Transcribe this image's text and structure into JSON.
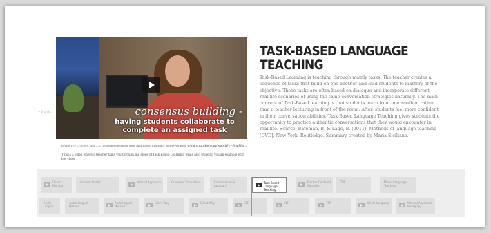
{
  "side_label": "~ 6 tasks",
  "video": {
    "caption_line1": "consensus building -",
    "caption_line2": "having students collaborate to complete an assigned task"
  },
  "citation": {
    "text": "BridgeTEFL. (2009, May 27). Teaching Speaking with Task-Based Learning. Retrieved from",
    "link": "www.youtube.com/watch?v=8jmWb..."
  },
  "video_description": "This is a video where a teacher talks you through the steps of Task-Based-Learning, while also showing you an example with her class.",
  "title": "TASK-BASED LANGUAGE TEACHING",
  "body": "Task-Based Learning is teaching through mainly tasks. The teacher creates a sequence of tasks that build on one another and lead students to mastery of the objective. These tasks are often based on dialogue and incorporate different real-life scenarios of using the same conversation strategies naturally. The main concept of Task-Based learning is that students learn from one another, rather than a teacher lecturing in front of the room. After, students feel more confident in their conversation abilities. Task-Based Language Teaching gives students the opportunity to practice authentic conversations that they would encounter in real-life. Source: Bateman, B. & Lago, B. (2011). Methods of language teaching [DVD]. New York: Routledge. Summary created by Maria Siciliano.",
  "timeline": {
    "row1": [
      {
        "label": "Direct Method",
        "icon": "image-icon"
      },
      {
        "label": "Content Based",
        "icon": null
      },
      {
        "label": "Natural Approach",
        "icon": "video-icon"
      },
      {
        "label": "Grammar Translation",
        "icon": null
      },
      {
        "label": "Communicative Approach",
        "icon": null
      },
      {
        "label": "Task-Based Language Teaching",
        "icon": "video-icon",
        "active": true
      },
      {
        "label": "Teacher Centered Education",
        "icon": "video-icon"
      },
      {
        "label": "TPR",
        "icon": null
      },
      {
        "label": "Mixed Language Teaching",
        "icon": null
      }
    ],
    "row2": [
      {
        "label": "Audio Lingual",
        "icon": null
      },
      {
        "label": "Audio Lingual Method",
        "icon": null
      },
      {
        "label": "Audiolingual Method",
        "icon": "video-icon"
      },
      {
        "label": "Silent Way",
        "icon": "video-icon"
      },
      {
        "label": "Silent Way",
        "icon": "video-icon"
      },
      {
        "label": "CLT",
        "icon": "video-icon"
      },
      {
        "label": "CLT",
        "icon": "video-icon"
      },
      {
        "label": "TPR",
        "icon": "video-icon"
      },
      {
        "label": "Whole Language",
        "icon": "video-icon"
      },
      {
        "label": "Natural Approach Pedagogy",
        "icon": "video-icon"
      }
    ]
  }
}
